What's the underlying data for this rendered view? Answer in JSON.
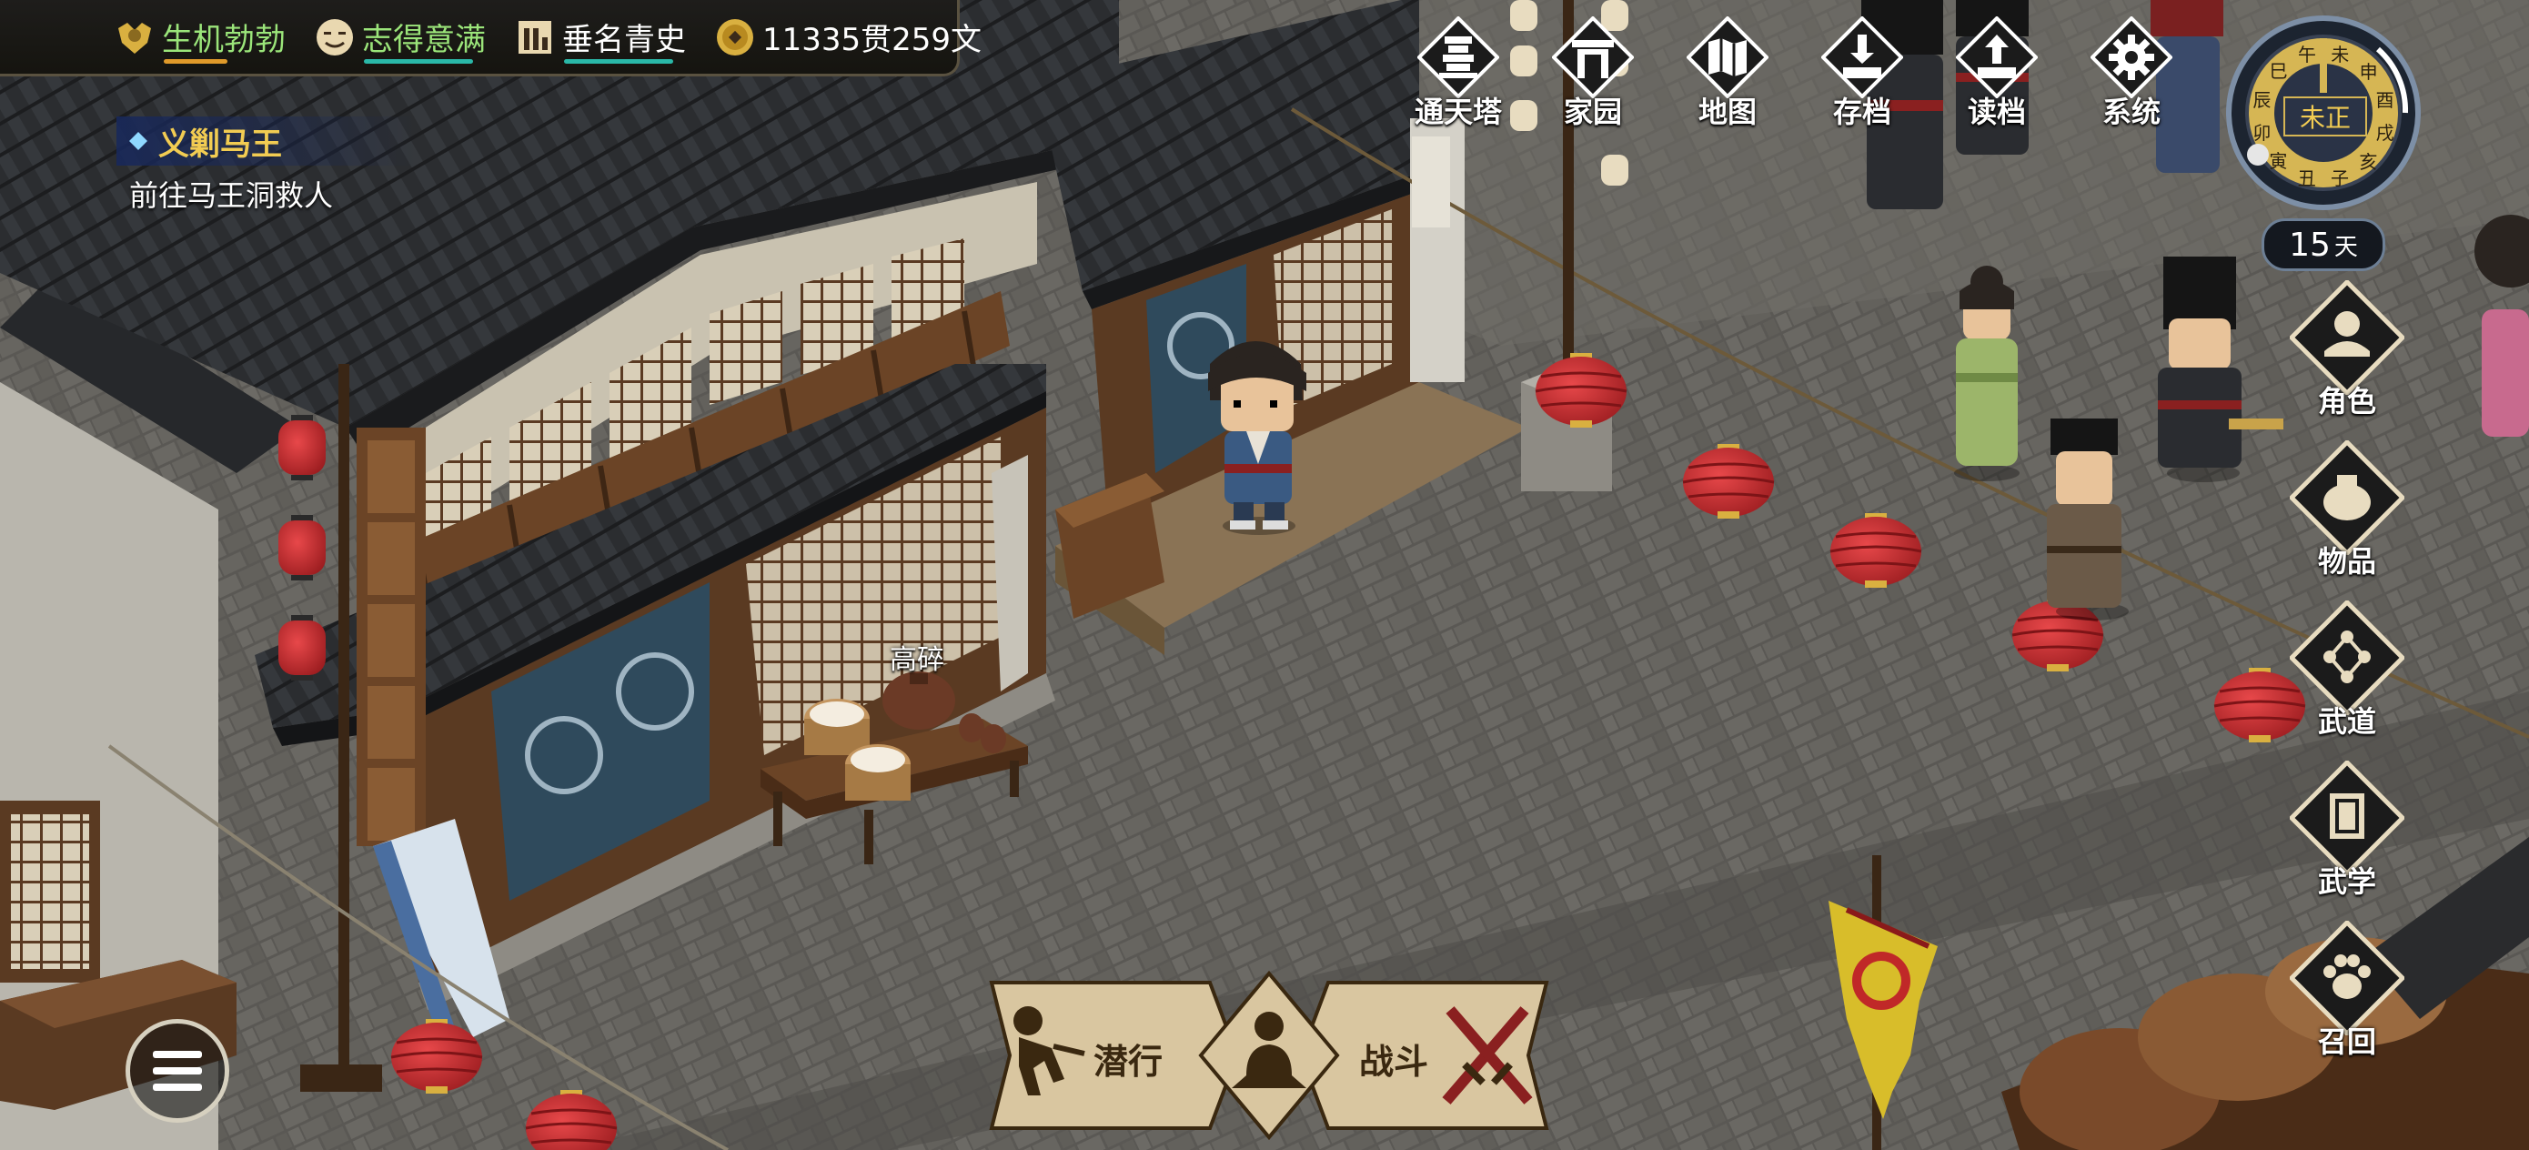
{
  "status_bar": {
    "health": "生机勃勃",
    "mood": "志得意满",
    "fame": "垂名青史",
    "money": "11335贯259文"
  },
  "quest": {
    "title": "义剿马王",
    "description": "前往马王洞救人"
  },
  "top_menu": [
    {
      "label": "通天塔",
      "icon": "tower-icon"
    },
    {
      "label": "家园",
      "icon": "gate-icon"
    },
    {
      "label": "地图",
      "icon": "map-icon"
    },
    {
      "label": "存档",
      "icon": "save-icon"
    },
    {
      "label": "读档",
      "icon": "load-icon"
    },
    {
      "label": "系统",
      "icon": "gear-icon"
    }
  ],
  "clock": {
    "current": "未正",
    "hours": [
      "午",
      "未",
      "申",
      "酉",
      "戌",
      "亥",
      "子",
      "丑",
      "寅",
      "卯",
      "辰",
      "巳"
    ]
  },
  "day": {
    "number": "15",
    "unit": "天"
  },
  "side_menu": [
    {
      "label": "角色",
      "icon": "person-icon"
    },
    {
      "label": "物品",
      "icon": "bag-icon"
    },
    {
      "label": "武道",
      "icon": "martial-path-icon"
    },
    {
      "label": "武学",
      "icon": "book-icon"
    },
    {
      "label": "召回",
      "icon": "paw-icon"
    }
  ],
  "actions": {
    "sneak": "潜行",
    "fight": "战斗"
  },
  "npc_name": "高碎",
  "colors": {
    "health_bar": "#e09a2a",
    "mood_bar": "#2ab8a8",
    "fame_bar": "#2ab8a8",
    "quest_title": "#f2cc52",
    "stat_text": "#9be57a",
    "lantern": "#c8282c"
  }
}
